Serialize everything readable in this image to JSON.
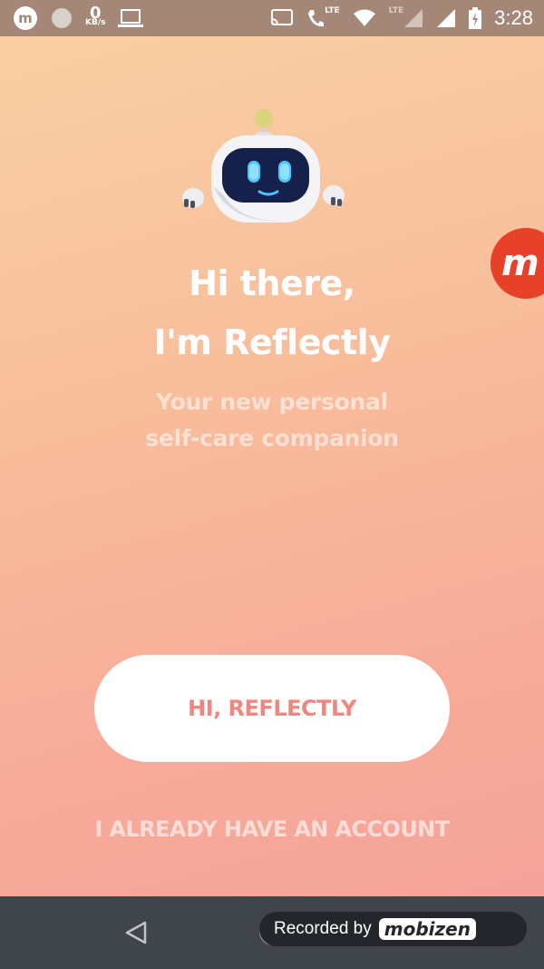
{
  "status_bar": {
    "speed_value": "0",
    "speed_unit": "KB/s",
    "lte1": "LTE",
    "lte2": "LTE",
    "time": "3:28"
  },
  "hero": {
    "title_line1": "Hi there,",
    "title_line2": "I'm Reflectly",
    "subtitle_line1": "Your new personal",
    "subtitle_line2": "self-care companion"
  },
  "actions": {
    "primary_label": "HI, REFLECTLY",
    "secondary_label": "I ALREADY HAVE AN ACCOUNT"
  },
  "floating_bubble": {
    "glyph": "m"
  },
  "recording": {
    "label": "Recorded by",
    "brand": "mobizen"
  },
  "colors": {
    "gradient_top": "#f9d1a4",
    "gradient_bottom": "#f4a29a",
    "button_text": "#f0867f",
    "status_bar": "#a48776",
    "nav_bar": "#40454a"
  }
}
